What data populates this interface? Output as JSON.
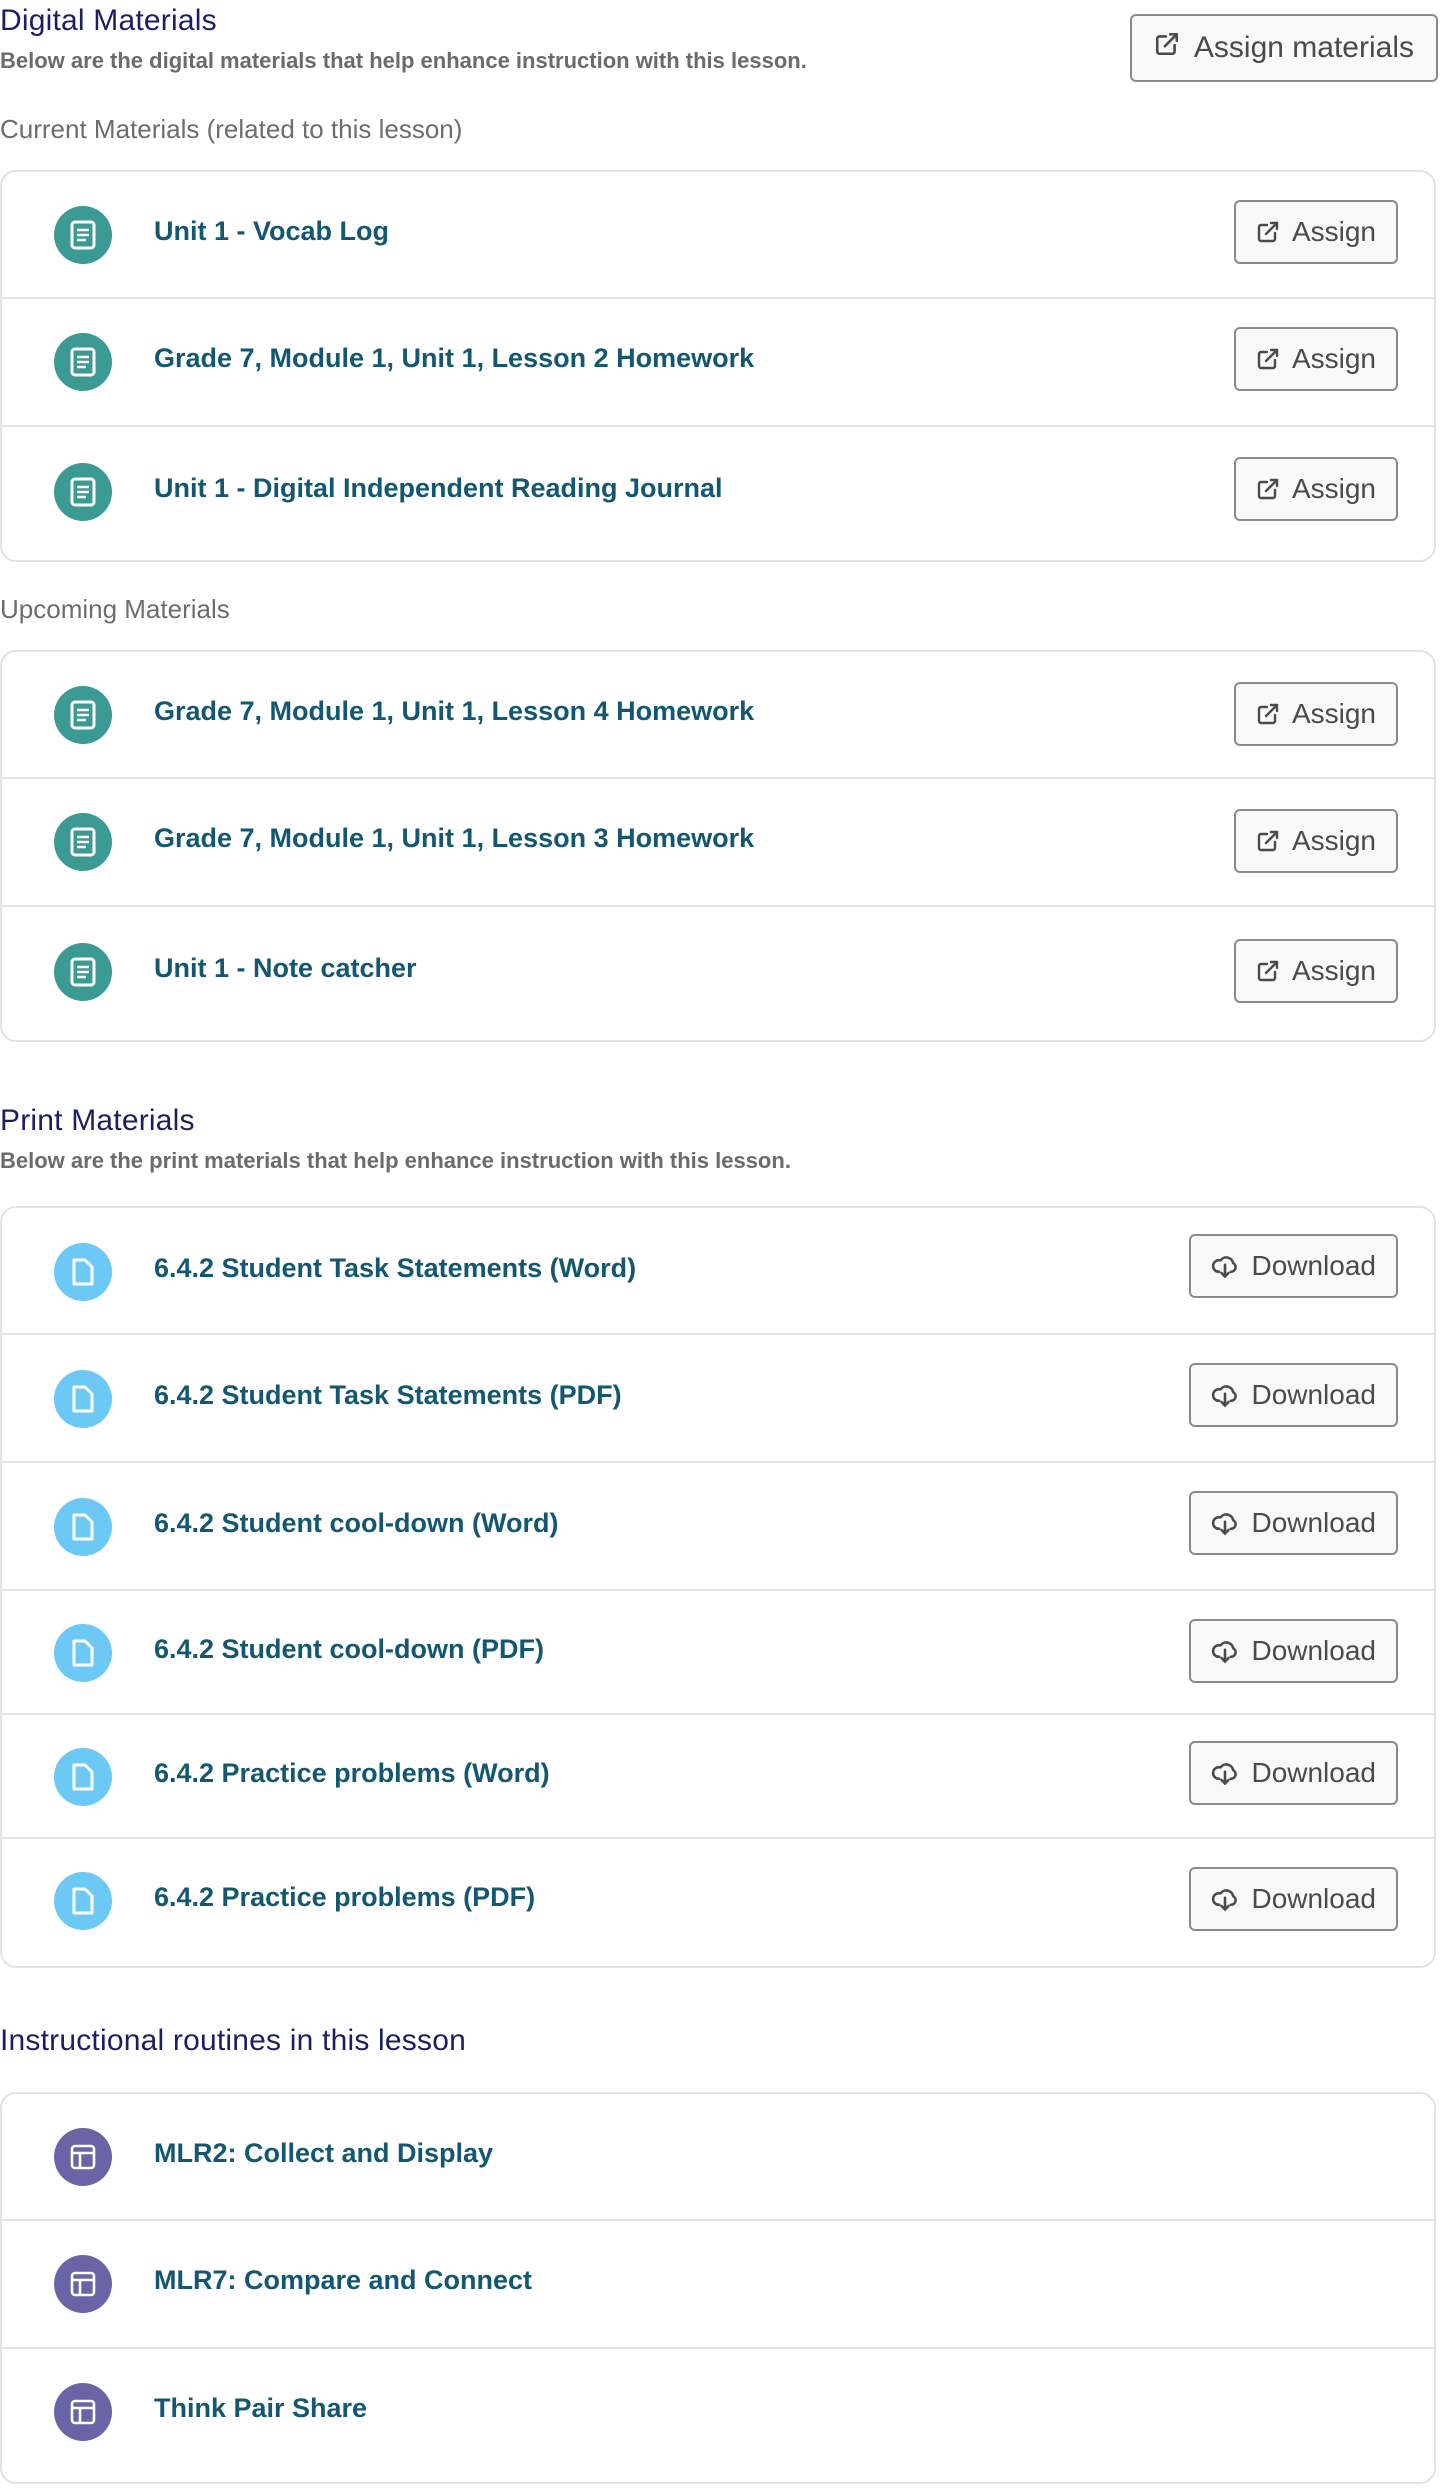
{
  "digital": {
    "title": "Digital Materials",
    "description": "Below are the digital materials that help enhance instruction with this lesson.",
    "assign_all_label": "Assign materials",
    "current": {
      "label": "Current Materials (related to this lesson)",
      "items": [
        {
          "title": "Unit 1 - Vocab Log",
          "action": "Assign"
        },
        {
          "title": "Grade 7, Module 1, Unit 1, Lesson 2 Homework",
          "action": "Assign"
        },
        {
          "title": "Unit 1 - Digital Independent Reading Journal",
          "action": "Assign"
        }
      ]
    },
    "upcoming": {
      "label": "Upcoming Materials",
      "items": [
        {
          "title": "Grade 7, Module 1, Unit 1, Lesson 4 Homework",
          "action": "Assign"
        },
        {
          "title": "Grade 7, Module 1, Unit 1, Lesson 3 Homework",
          "action": "Assign"
        },
        {
          "title": "Unit 1 - Note catcher",
          "action": "Assign"
        }
      ]
    }
  },
  "print": {
    "title": "Print Materials",
    "description": "Below are the print materials that help enhance instruction with this lesson.",
    "items": [
      {
        "title": "6.4.2 Student Task Statements (Word)",
        "action": "Download"
      },
      {
        "title": "6.4.2 Student Task Statements (PDF)",
        "action": "Download"
      },
      {
        "title": "6.4.2 Student cool-down (Word)",
        "action": "Download"
      },
      {
        "title": "6.4.2 Student cool-down (PDF)",
        "action": "Download"
      },
      {
        "title": "6.4.2 Practice problems (Word)",
        "action": "Download"
      },
      {
        "title": "6.4.2 Practice problems (PDF)",
        "action": "Download"
      }
    ]
  },
  "routines": {
    "title": "Instructional routines in this lesson",
    "items": [
      {
        "title": "MLR2: Collect and Display"
      },
      {
        "title": "MLR7: Compare and Connect"
      },
      {
        "title": "Think Pair Share"
      }
    ]
  },
  "colors": {
    "heading": "#1d1d66",
    "link": "#135770",
    "digital_icon": "#3b9a94",
    "print_icon": "#6cc8f5",
    "routine_icon": "#6a64a6"
  },
  "icons": {
    "digital_item": "document-lines-icon",
    "print_item": "file-icon",
    "routine_item": "layout-icon",
    "assign": "external-link-icon",
    "download": "cloud-download-icon"
  }
}
